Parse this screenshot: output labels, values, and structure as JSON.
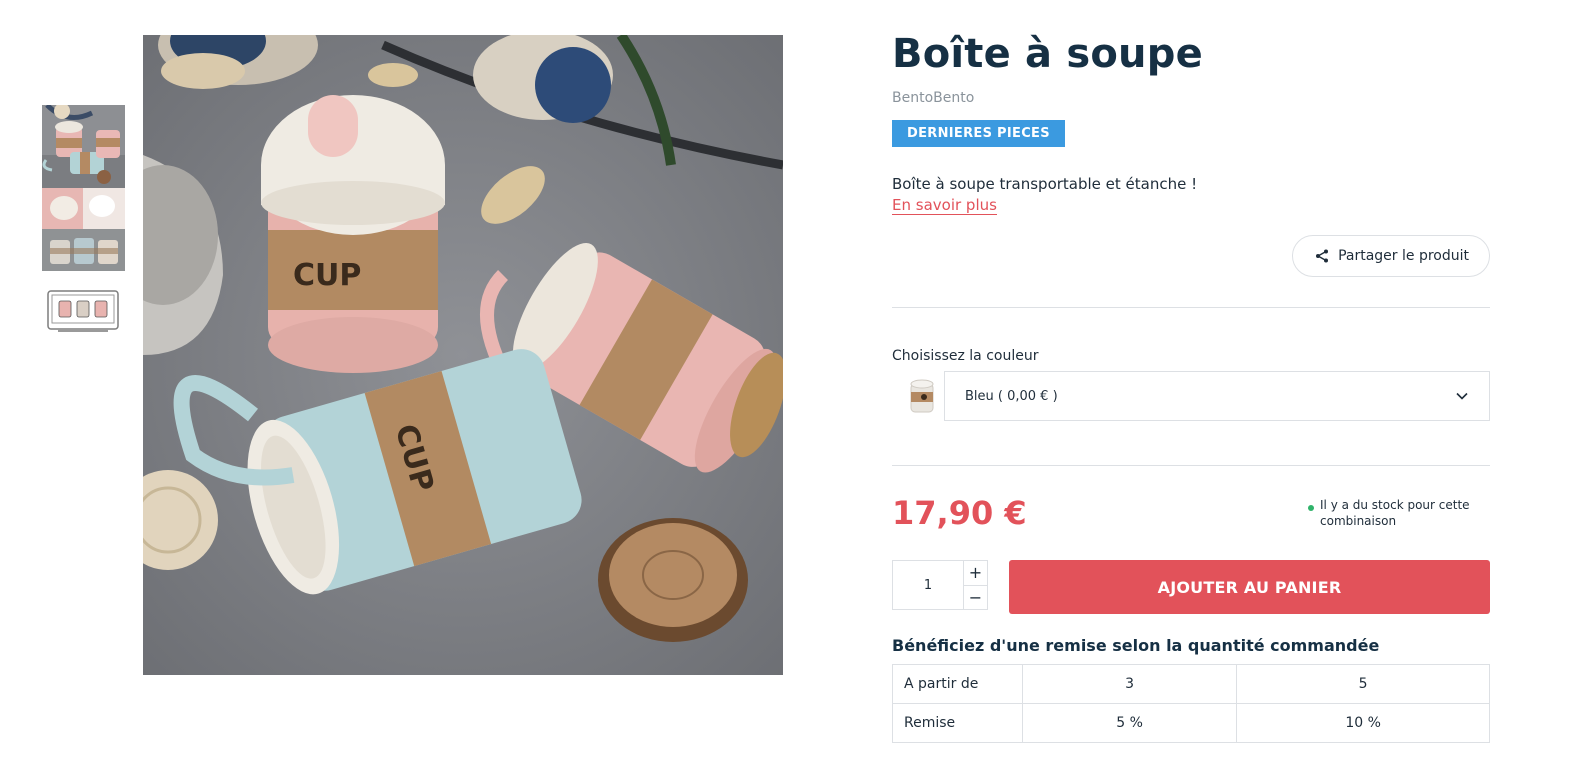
{
  "product": {
    "title": "Boîte à soupe",
    "brand": "BentoBento",
    "badge": "DERNIERES PIECES",
    "short_description": "Boîte à soupe transportable et étanche !",
    "more_link": "En savoir plus",
    "share_label": "Partager le produit",
    "price": "17,90 €",
    "stock_text": "Il y a du stock pour cette combinaison"
  },
  "variant": {
    "label": "Choisissez la couleur",
    "selected": "Bleu ( 0,00 € )"
  },
  "cart": {
    "quantity": "1",
    "plus": "+",
    "minus": "−",
    "add_label": "AJOUTER AU PANIER"
  },
  "discounts": {
    "title": "Bénéficiez d'une remise selon la quantité commandée",
    "header_label": "A partir de",
    "row_label": "Remise",
    "quantities": [
      "3",
      "5"
    ],
    "values": [
      "5 %",
      "10 %"
    ]
  },
  "colors": {
    "accent": "#e2525a",
    "badge": "#3b9ae0",
    "heading": "#163044",
    "stock": "#2fb36a"
  }
}
